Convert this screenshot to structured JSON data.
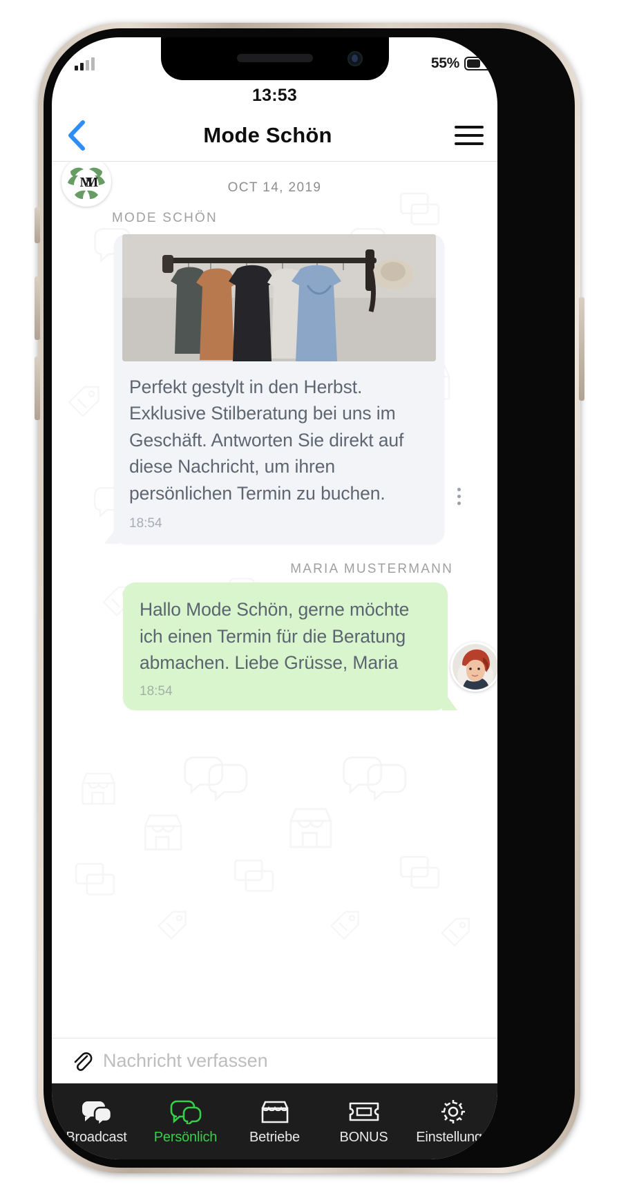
{
  "status_bar": {
    "battery_percent": "55%",
    "battery_level": 55,
    "signal_icon": "cellular-signal-icon",
    "clock": "13:53"
  },
  "nav": {
    "back_icon": "chevron-left-icon",
    "title": "Mode Schön",
    "menu_icon": "hamburger-menu-icon"
  },
  "chat": {
    "date_separator": "OCT 14, 2019",
    "messages": [
      {
        "direction": "incoming",
        "sender": "MODE SCHÖN",
        "has_image": true,
        "image_alt": "clothes-rack-photo",
        "text": "Perfekt gestylt in den Herbst. Exklusive Stilberatung bei uns im Geschäft. Antworten Sie direkt auf diese Nachricht, um ihren persönlichen Termin zu buchen.",
        "time": "18:54",
        "avatar": "mode-schoen-logo-avatar",
        "menu_icon": "vertical-dots-icon"
      },
      {
        "direction": "outgoing",
        "sender": "MARIA MUSTERMANN",
        "has_image": false,
        "text": "Hallo Mode Schön, gerne möchte ich einen Termin für die Beratung abmachen. Liebe Grüsse, Maria",
        "time": "18:54",
        "avatar": "maria-mustermann-photo-avatar"
      }
    ]
  },
  "composer": {
    "attach_icon": "paperclip-icon",
    "placeholder": "Nachricht verfassen",
    "value": ""
  },
  "tabbar": {
    "active_color": "#34d048",
    "items": [
      {
        "label": "Broadcast",
        "icon": "speech-bubbles-icon",
        "active": false
      },
      {
        "label": "Persönlich",
        "icon": "speech-bubbles-icon",
        "active": true
      },
      {
        "label": "Betriebe",
        "icon": "storefront-icon",
        "active": false
      },
      {
        "label": "BONUS",
        "icon": "ticket-icon",
        "active": false
      },
      {
        "label": "Einstellunge",
        "icon": "gear-icon",
        "active": false
      }
    ]
  },
  "colors": {
    "incoming_bubble": "#f3f4f7",
    "outgoing_bubble": "#d8f5cd",
    "accent_blue": "#2f8cf7",
    "tabbar_bg": "#1d1d1d"
  }
}
